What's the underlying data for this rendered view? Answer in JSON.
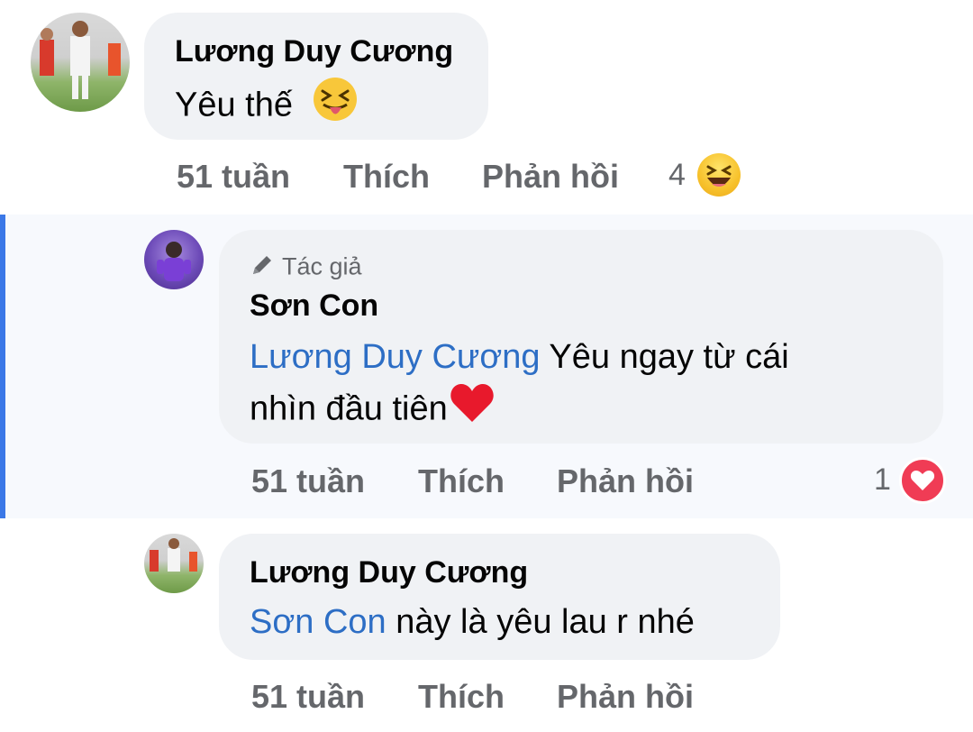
{
  "comments": [
    {
      "author": "Lương Duy Cương",
      "text": "Yêu thế",
      "text_emoji": "squinting-tongue",
      "time": "51 tuần",
      "like_label": "Thích",
      "reply_label": "Phản hồi",
      "reaction_count": "4",
      "reaction_type": "haha"
    },
    {
      "author_badge": "Tác giả",
      "author": "Sơn Con",
      "mention": "Lương Duy Cương",
      "text_line1": " Yêu ngay từ cái",
      "text_line2": "nhìn đầu tiên",
      "text_emoji": "red-heart",
      "time": "51 tuần",
      "like_label": "Thích",
      "reply_label": "Phản hồi",
      "reaction_count": "1",
      "reaction_type": "love"
    },
    {
      "author": "Lương Duy Cương",
      "mention": "Sơn Con",
      "text": " này là yêu lau r nhé",
      "time": "51 tuần",
      "like_label": "Thích",
      "reply_label": "Phản hồi"
    }
  ],
  "colors": {
    "bubble": "#f0f2f5",
    "mention": "#2d6ec5",
    "meta": "#65676b",
    "highlight_bar": "#3b78e7"
  }
}
